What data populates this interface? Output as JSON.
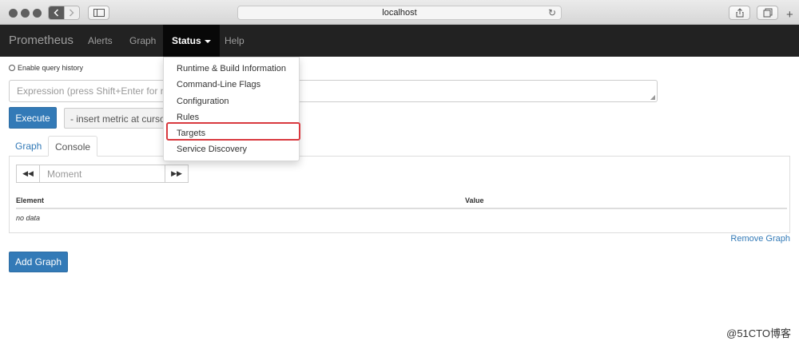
{
  "browser": {
    "url": "localhost"
  },
  "navbar": {
    "brand": "Prometheus",
    "links": [
      "Alerts",
      "Graph",
      "Status",
      "Help"
    ]
  },
  "query": {
    "history_label": "Enable query history",
    "expression_placeholder": "Expression (press Shift+Enter for newlines)",
    "execute_label": "Execute",
    "metric_select": "- insert metric at cursor"
  },
  "tabs": [
    "Graph",
    "Console"
  ],
  "console": {
    "moment_placeholder": "Moment",
    "columns": [
      "Element",
      "Value"
    ],
    "empty": "no data"
  },
  "remove_graph": "Remove Graph",
  "add_graph": "Add Graph",
  "status_menu": [
    "Runtime & Build Information",
    "Command-Line Flags",
    "Configuration",
    "Rules",
    "Targets",
    "Service Discovery"
  ],
  "watermark": "@51CTO博客",
  "colors": {
    "navbar": "#222222",
    "primary": "#337ab7",
    "highlight": "#d9393f"
  }
}
